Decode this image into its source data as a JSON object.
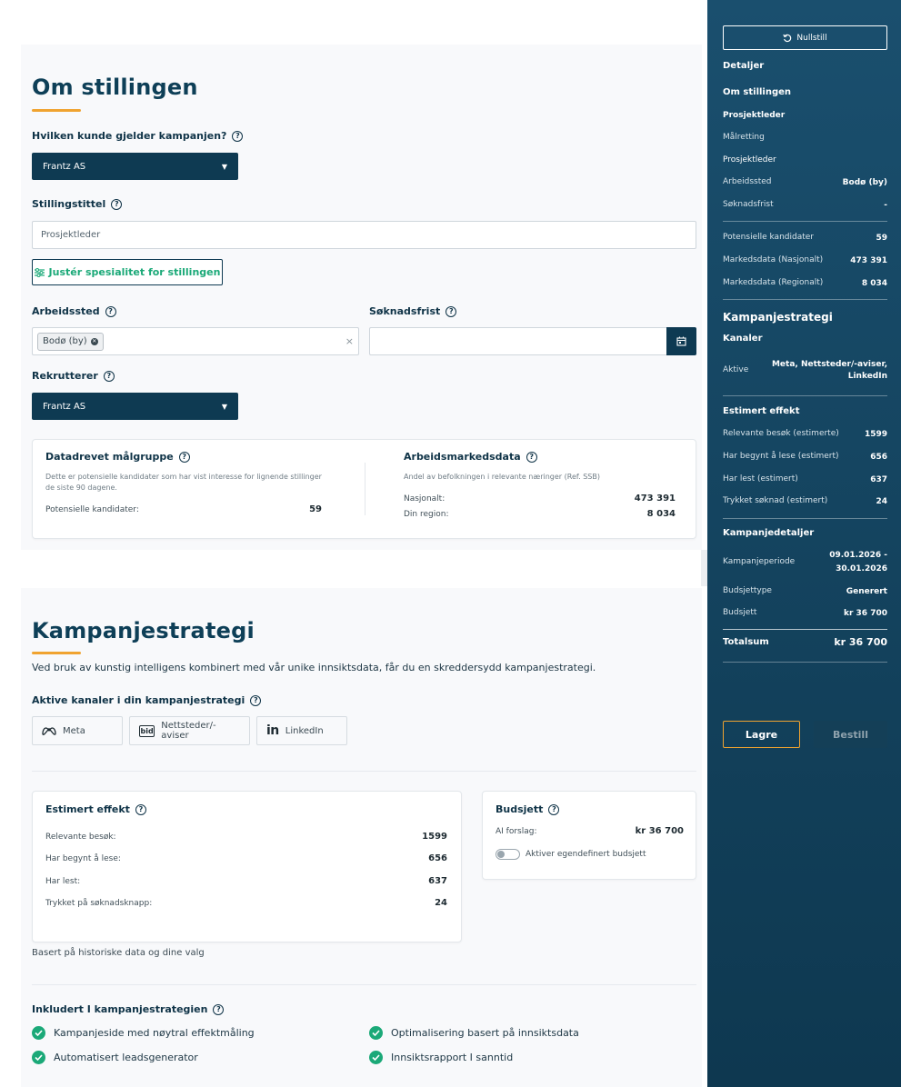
{
  "om": {
    "title": "Om stillingen",
    "kunde_label": "Hvilken kunde gjelder kampanjen?",
    "kunde_value": "Frantz AS",
    "tittel_label": "Stillingstittel",
    "tittel_value": "Prosjektleder",
    "juster_label": "Justér spesialitet for stillingen",
    "arbeidssted_label": "Arbeidssted",
    "arbeidssted_chip": "Bodø (by)",
    "clear_symbol": "×",
    "soknadsfrist_label": "Søknadsfrist",
    "rekrutterer_label": "Rekrutterer",
    "rekrutterer_value": "Frantz AS"
  },
  "malgruppe": {
    "title": "Datadrevet målgruppe",
    "desc": "Dette er potensielle kandidater som har vist interesse for lignende stillinger de siste 90 dagene.",
    "kandidater_label": "Potensielle kandidater:",
    "kandidater_value": "59"
  },
  "arbeidsmarked": {
    "title": "Arbeidsmarkedsdata",
    "desc": "Andel av befolkningen i relevante næringer (Ref. SSB)",
    "nasjonalt_label": "Nasjonalt:",
    "nasjonalt_value": "473 391",
    "region_label": "Din region:",
    "region_value": "8 034"
  },
  "kampanje": {
    "title": "Kampanjestrategi",
    "intro": "Ved bruk av kunstig intelligens kombinert med vår unike innsiktsdata, får du en skreddersydd kampanjestrategi.",
    "kanaler_label": "Aktive kanaler i din kampanjestrategi",
    "channels": [
      "Meta",
      "Nettsteder/-aviser",
      "LinkedIn"
    ],
    "channel_icons": [
      "meta-icon",
      "bid-icon",
      "linkedin-icon"
    ],
    "bid_logo_text": "bid",
    "linkedin_logo_text": "in"
  },
  "effekt": {
    "title": "Estimert effekt",
    "rows": [
      {
        "label": "Relevante besøk:",
        "value": "1599"
      },
      {
        "label": "Har begynt å lese:",
        "value": "656"
      },
      {
        "label": "Har lest:",
        "value": "637"
      },
      {
        "label": "Trykket på søknadsknapp:",
        "value": "24"
      }
    ],
    "note": "Basert på historiske data og dine valg"
  },
  "budsjett": {
    "title": "Budsjett",
    "ai_label": "AI forslag:",
    "ai_value": "kr 36 700",
    "toggle_label": "Aktiver egendefinert budsjett"
  },
  "inkludert": {
    "title": "Inkludert I kampanjestrategien",
    "items": [
      "Kampanjeside med nøytral effektmåling",
      "Optimalisering basert på innsiktsdata",
      "Automatisert leadsgenerator",
      "Innsiktsrapport I sanntid"
    ]
  },
  "sidebar": {
    "reset_label": "Nullstill",
    "detaljer": "Detaljer",
    "om_stillingen": "Om stillingen",
    "job_title": "Prosjektleder",
    "malretting": "Målretting",
    "malretting_value": "Prosjektleder",
    "arbeidssted_label": "Arbeidssted",
    "arbeidssted_value": "Bodø (by)",
    "soknadsfrist_label": "Søknadsfrist",
    "soknadsfrist_value": "-",
    "pot_label": "Potensielle kandidater",
    "pot_value": "59",
    "nasj_label": "Markedsdata (Nasjonalt)",
    "nasj_value": "473 391",
    "reg_label": "Markedsdata (Regionalt)",
    "reg_value": "8 034",
    "strategi": "Kampanjestrategi",
    "kanaler": "Kanaler",
    "aktive_label": "Aktive",
    "aktive_value_1": "Meta, Nettsteder/-aviser,",
    "aktive_value_2": "LinkedIn",
    "estimert": "Estimert effekt",
    "est_rows": [
      {
        "label": "Relevante besøk (estimerte)",
        "value": "1599"
      },
      {
        "label": "Har begynt å lese (estimert)",
        "value": "656"
      },
      {
        "label": "Har lest (estimert)",
        "value": "637"
      },
      {
        "label": "Trykket søknad (estimert)",
        "value": "24"
      }
    ],
    "detaljer2": "Kampanjedetaljer",
    "periode_label": "Kampanjeperiode",
    "periode_value_1": "09.01.2026 -",
    "periode_value_2": "30.01.2026",
    "budsjettype_label": "Budsjettype",
    "budsjettype_value": "Generert",
    "budsjett_label": "Budsjett",
    "budsjett_value": "kr 36 700",
    "totalsum_label": "Totalsum",
    "totalsum_value": "kr 36 700",
    "lagre": "Lagre",
    "bestill": "Bestill"
  },
  "colors": {
    "navy": "#0e3a52",
    "accent_orange": "#f0a330",
    "accent_green": "#1ba978"
  },
  "help_symbol": "?"
}
